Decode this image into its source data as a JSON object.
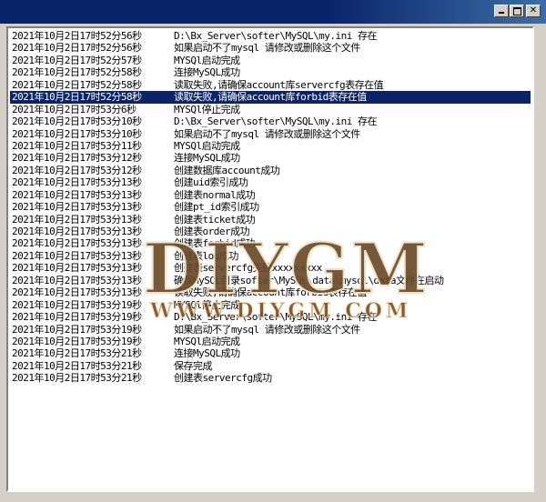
{
  "colors": {
    "titlebar": "#0a246a",
    "selection": "#0a246a",
    "face": "#d4d0c8"
  },
  "log": [
    {
      "time": "2021年10月2日17时52分56秒",
      "msg": "D:\\Bx_Server\\softer\\MySQL\\my.ini 存在"
    },
    {
      "time": "2021年10月2日17时52分56秒",
      "msg": "如果启动不了mysql 请修改或删除这个文件"
    },
    {
      "time": "2021年10月2日17时52分57秒",
      "msg": "MYSQl启动完成"
    },
    {
      "time": "2021年10月2日17时52分58秒",
      "msg": "连接MySQL成功"
    },
    {
      "time": "2021年10月2日17时52分58秒",
      "msg": "读取失败,请确保account库servercfg表存在值"
    },
    {
      "time": "2021年10月2日17时52分58秒",
      "msg": "读取失败,请确保account库forbid表存在值"
    },
    {
      "time": "2021年10月2日17时53分6秒",
      "msg": "MYSQl停止完成"
    },
    {
      "time": "2021年10月2日17时53分10秒",
      "msg": "D:\\Bx_Server\\softer\\MySQL\\my.ini 存在"
    },
    {
      "time": "2021年10月2日17时53分10秒",
      "msg": "如果启动不了mysql 请修改或删除这个文件"
    },
    {
      "time": "2021年10月2日17时53分11秒",
      "msg": "MYSQl启动完成"
    },
    {
      "time": "2021年10月2日17时53分12秒",
      "msg": "连接MySQL成功"
    },
    {
      "time": "2021年10月2日17时53分12秒",
      "msg": "创建数据库account成功"
    },
    {
      "time": "2021年10月2日17时53分13秒",
      "msg": "创建uid索引成功"
    },
    {
      "time": "2021年10月2日17时53分13秒",
      "msg": "创建表normal成功"
    },
    {
      "time": "2021年10月2日17时53分13秒",
      "msg": "创建pt_id索引成功"
    },
    {
      "time": "2021年10月2日17时53分13秒",
      "msg": "创建表ticket成功"
    },
    {
      "time": "2021年10月2日17时53分13秒",
      "msg": "创建表order成功"
    },
    {
      "time": "2021年10月2日17时53分13秒",
      "msg": "创建表forbid成功"
    },
    {
      "time": "2021年10月2日17时53分13秒",
      "msg": "创建表log成功"
    },
    {
      "time": "2021年10月2日17时53分13秒",
      "msg": "创建表servercfg失败xxxxxxxxx"
    },
    {
      "time": "2021年10月2日17时53分13秒",
      "msg": "确保MySQL目录softer\\MySQL\\data\\mysql\\data文件在启动"
    },
    {
      "time": "2021年10月2日17时53分13秒",
      "msg": "读取失败,请确保account库forbid表存在值"
    },
    {
      "time": "2021年10月2日17时53分19秒",
      "msg": "MYSQl停止完成"
    },
    {
      "time": "2021年10月2日17时53分19秒",
      "msg": "D:\\Bx_Server\\softer\\MySQL\\my.ini 存在"
    },
    {
      "time": "2021年10月2日17时53分19秒",
      "msg": "如果启动不了mysql 请修改或删除这个文件"
    },
    {
      "time": "2021年10月2日17时53分19秒",
      "msg": "MYSQl启动完成"
    },
    {
      "time": "2021年10月2日17时53分21秒",
      "msg": "连接MySQL成功"
    },
    {
      "time": "2021年10月2日17时53分21秒",
      "msg": "保存完成"
    },
    {
      "time": "2021年10月2日17时53分21秒",
      "msg": "创建表servercfg成功"
    }
  ],
  "selected_index": 5,
  "watermark": {
    "main": "DIYGM",
    "sub": "WWW.DIYGM.COM"
  }
}
